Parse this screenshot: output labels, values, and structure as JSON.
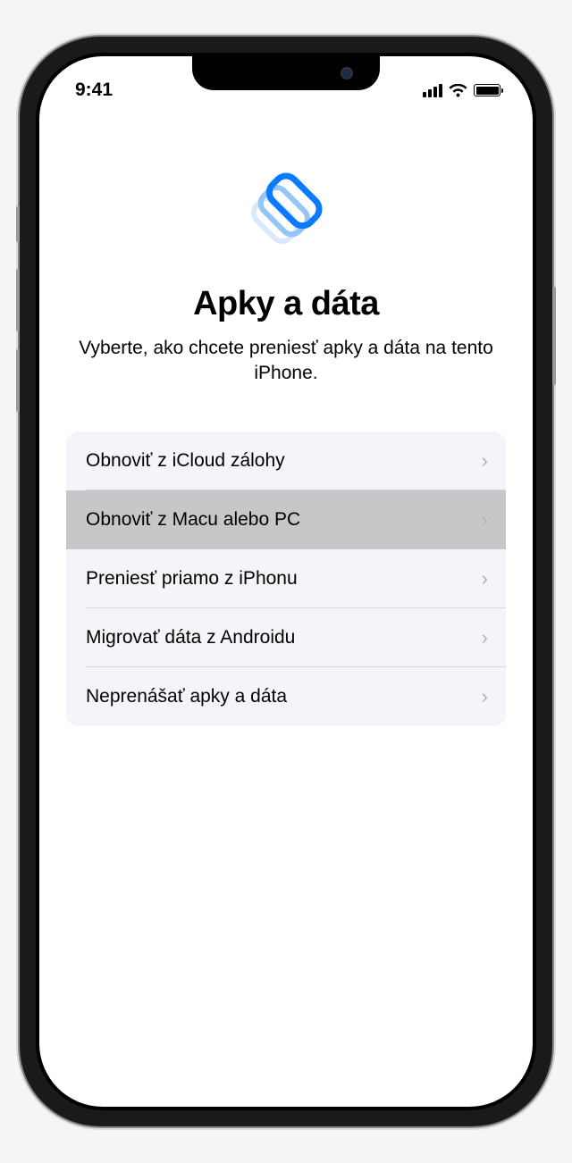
{
  "status": {
    "time": "9:41"
  },
  "page": {
    "title": "Apky a dáta",
    "subtitle": "Vyberte, ako chcete preniesť apky a dáta na tento iPhone."
  },
  "options": [
    {
      "label": "Obnoviť z iCloud zálohy",
      "selected": false
    },
    {
      "label": "Obnoviť z Macu alebo PC",
      "selected": true
    },
    {
      "label": "Preniesť priamo z iPhonu",
      "selected": false
    },
    {
      "label": "Migrovať dáta z Androidu",
      "selected": false
    },
    {
      "label": "Neprenášať apky a dáta",
      "selected": false
    }
  ]
}
